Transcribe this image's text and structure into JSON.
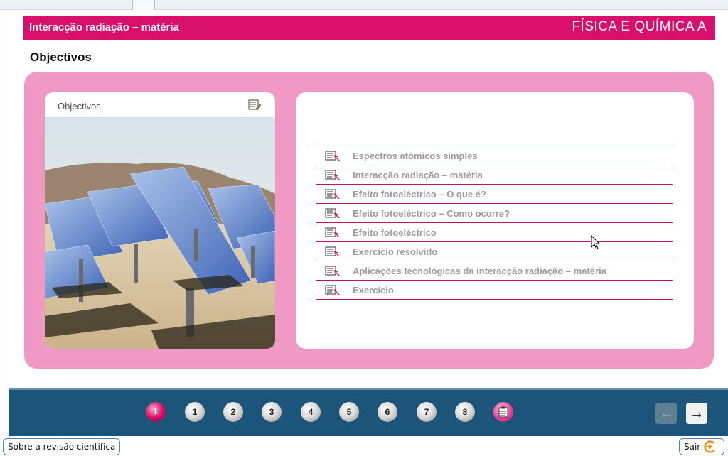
{
  "header": {
    "title": "Interacção radiação – matéria",
    "subject": "FÍSICA E QUÍMICA A"
  },
  "page": {
    "title": "Objectivos"
  },
  "left_card": {
    "label": "Objectivos:",
    "note_icon": "notepad-pencil-icon",
    "photo": "solar-panels-desert-photo"
  },
  "topics": [
    {
      "label": "Espectros atómicos simples",
      "icon": "document-arrow-icon"
    },
    {
      "label": "Interacção radiação – matéria",
      "icon": "document-arrow-icon"
    },
    {
      "label": "Efeito fotoeléctrico – O que é?",
      "icon": "document-arrow-icon"
    },
    {
      "label": "Efeito fotoeléctrico – Como ocorre?",
      "icon": "document-arrow-icon"
    },
    {
      "label": "Efeito fotoeléctrico",
      "icon": "document-arrow-icon"
    },
    {
      "label": "Exercício resolvido",
      "icon": "document-arrow-icon"
    },
    {
      "label": "Aplicações tecnológicas da interacção radiação – matéria",
      "icon": "document-arrow-icon"
    },
    {
      "label": "Exercício",
      "icon": "document-arrow-icon"
    }
  ],
  "nav": {
    "intro": "I",
    "pages": [
      "1",
      "2",
      "3",
      "4",
      "5",
      "6",
      "7",
      "8"
    ],
    "summary_icon": "clipboard-icon",
    "prev_icon": "arrow-left-icon",
    "next_icon": "arrow-right-icon"
  },
  "footer": {
    "revisao": "Sobre a revisão científica",
    "sair": "Sair",
    "sair_icon": "exit-arrow-icon"
  },
  "colors": {
    "brand": "#d8106c",
    "panel": "#f199c5",
    "navbar": "#1c5579",
    "topic_text": "#9c9c9c"
  }
}
